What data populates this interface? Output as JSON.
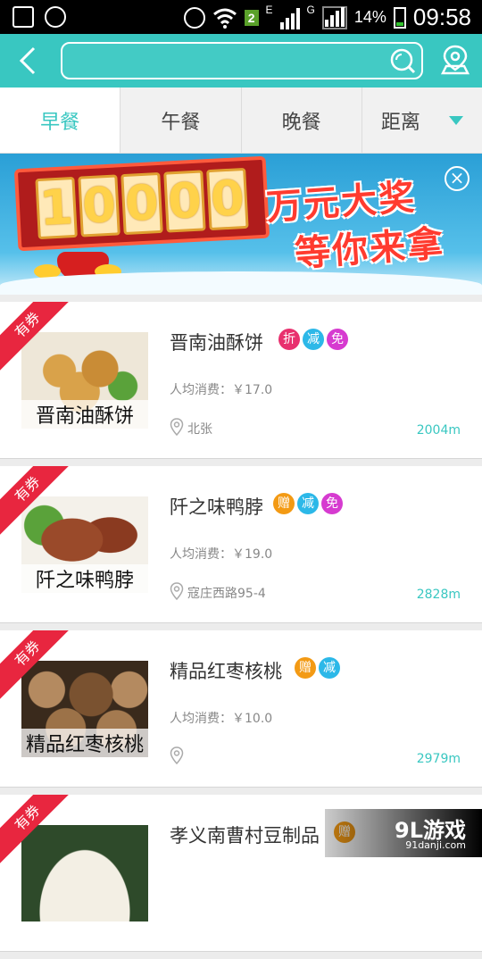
{
  "status_bar": {
    "carrier_badge": "2",
    "data_e": "E",
    "data_g": "G",
    "battery": "14%",
    "time": "09:58"
  },
  "header": {
    "search_value": "",
    "search_placeholder": ""
  },
  "tabs": [
    {
      "label": "早餐",
      "active": true
    },
    {
      "label": "午餐",
      "active": false
    },
    {
      "label": "晚餐",
      "active": false
    },
    {
      "label": "距离",
      "active": false
    }
  ],
  "banner": {
    "digits": [
      "1",
      "0",
      "0",
      "0",
      "0"
    ],
    "title": "万元大奖",
    "subtitle": "等你来拿",
    "close": "×"
  },
  "listings": [
    {
      "ribbon": "有券",
      "name": "晋南油酥饼",
      "image_caption": "晋南油酥饼",
      "tags": [
        {
          "text": "折",
          "color": "#e8306e"
        },
        {
          "text": "减",
          "color": "#2cb8e8"
        },
        {
          "text": "免",
          "color": "#d63bd0"
        }
      ],
      "avg": "人均消费：￥17.0",
      "address": "北张",
      "distance": "2004m"
    },
    {
      "ribbon": "有券",
      "name": "阡之味鸭脖",
      "image_caption": "阡之味鸭脖",
      "tags": [
        {
          "text": "赠",
          "color": "#f39a14"
        },
        {
          "text": "减",
          "color": "#2cb8e8"
        },
        {
          "text": "免",
          "color": "#d63bd0"
        }
      ],
      "avg": "人均消费：￥19.0",
      "address": "寇庄西路95-4",
      "distance": "2828m"
    },
    {
      "ribbon": "有券",
      "name": "精品红枣核桃",
      "image_caption": "精品红枣核桃",
      "tags": [
        {
          "text": "赠",
          "color": "#f39a14"
        },
        {
          "text": "减",
          "color": "#2cb8e8"
        }
      ],
      "avg": "人均消费：￥10.0",
      "address": "",
      "distance": "2979m"
    },
    {
      "ribbon": "有券",
      "name": "孝义南曹村豆制品",
      "image_caption": "",
      "tags": [
        {
          "text": "赠",
          "color": "#f39a14"
        }
      ],
      "avg": "",
      "address": "",
      "distance": ""
    }
  ],
  "watermark": {
    "brand": "9L游戏",
    "url": "91danji.com"
  },
  "colors": {
    "accent": "#39c7c1",
    "ribbon": "#e8263f"
  }
}
